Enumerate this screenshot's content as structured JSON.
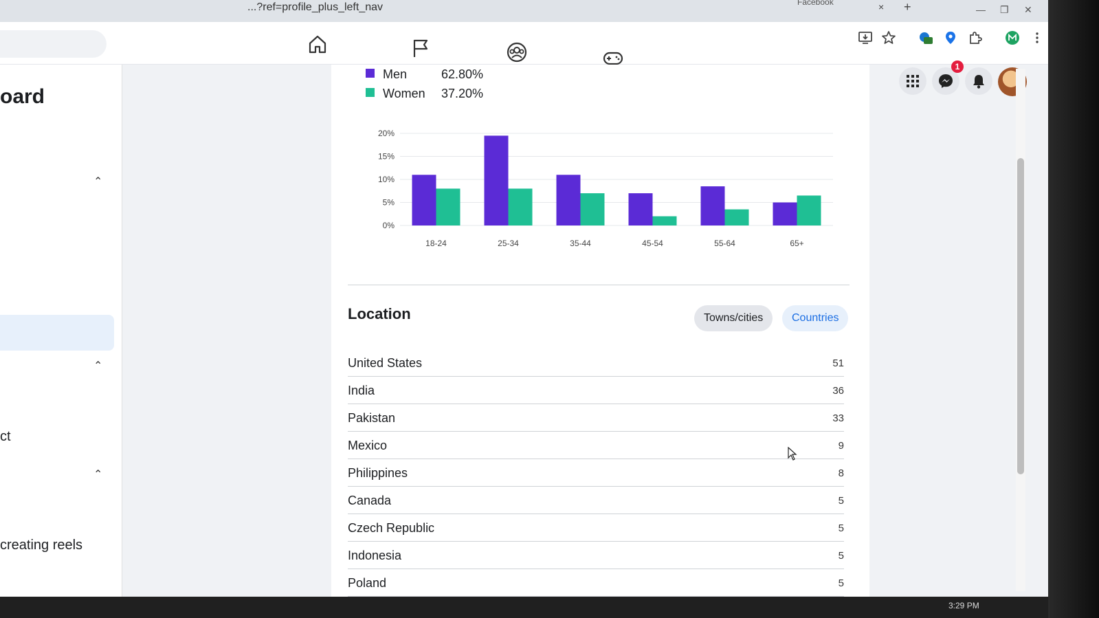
{
  "browser": {
    "tab_title": "...?ref=profile_plus_left_nav",
    "second_tab": "Facebook",
    "tab_close": "×",
    "new_tab": "+"
  },
  "sidebar": {
    "title": "oard",
    "items": [
      {
        "label": "ct"
      },
      {
        "label": "creating reels"
      }
    ]
  },
  "gender_legend": [
    {
      "label": "Men",
      "value": "62.80%",
      "color": "#5b2bd6"
    },
    {
      "label": "Women",
      "value": "37.20%",
      "color": "#1fbf94"
    }
  ],
  "chart_data": {
    "type": "bar",
    "categories": [
      "18-24",
      "25-34",
      "35-44",
      "45-54",
      "55-64",
      "65+"
    ],
    "series": [
      {
        "name": "Men",
        "values": [
          11,
          19.5,
          11,
          7,
          8.5,
          5
        ],
        "color": "#5b2bd6"
      },
      {
        "name": "Women",
        "values": [
          8,
          8,
          7,
          2,
          3.5,
          6.5
        ],
        "color": "#1fbf94"
      }
    ],
    "y_ticks": [
      "20%",
      "15%",
      "10%",
      "5%",
      "0%"
    ],
    "ylim": [
      0,
      20
    ],
    "grid": true
  },
  "location": {
    "title": "Location",
    "tabs": [
      {
        "label": "Towns/cities",
        "active": false
      },
      {
        "label": "Countries",
        "active": true
      }
    ],
    "rows": [
      {
        "country": "United States",
        "count": "51"
      },
      {
        "country": "India",
        "count": "36"
      },
      {
        "country": "Pakistan",
        "count": "33"
      },
      {
        "country": "Mexico",
        "count": "9"
      },
      {
        "country": "Philippines",
        "count": "8"
      },
      {
        "country": "Canada",
        "count": "5"
      },
      {
        "country": "Czech Republic",
        "count": "5"
      },
      {
        "country": "Indonesia",
        "count": "5"
      },
      {
        "country": "Poland",
        "count": "5"
      }
    ]
  },
  "notifications": {
    "messenger_badge": "1"
  },
  "taskbar": {
    "time": "3:29 PM"
  },
  "icons": [
    "home-icon",
    "flag-icon",
    "groups-icon",
    "gaming-icon",
    "apps-grid-icon",
    "messenger-icon",
    "bell-icon"
  ]
}
